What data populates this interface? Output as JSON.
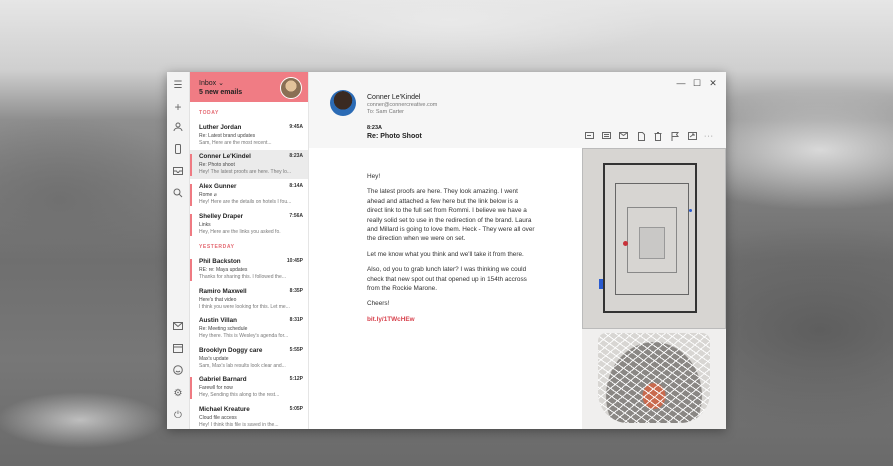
{
  "sidebar_icons": [
    "menu-icon",
    "plus-icon",
    "person-icon",
    "phone-icon",
    "inbox-tray-icon",
    "search-icon",
    "mail-icon",
    "calendar-icon",
    "smiley-icon",
    "gear-icon",
    "power-icon"
  ],
  "list": {
    "folder": "Inbox ⌄",
    "new_count": "5 new emails",
    "sections": {
      "today": "TODAY",
      "yesterday": "YESTERDAY"
    },
    "emails": [
      {
        "name": "Luther Jordan",
        "time": "9:45A",
        "subject": "Re: Latest brand updates",
        "preview": "Sam, Here are the most recent...",
        "flag": false,
        "selected": false
      },
      {
        "name": "Conner Le'Kindel",
        "time": "8:23A",
        "subject": "Re: Photo shoot",
        "preview": "Hey! The latest proofs are here. They lo...",
        "flag": true,
        "selected": true
      },
      {
        "name": "Alex Gunner",
        "time": "8:14A",
        "subject": "Rome ⌀",
        "preview": "Hey! Here are the details on hotels I fou...",
        "flag": true,
        "selected": false
      },
      {
        "name": "Shelley Draper",
        "time": "7:56A",
        "subject": "Links",
        "preview": "Hey, Here are the links you asked fo.",
        "flag": true,
        "selected": false
      },
      {
        "name": "Phil Backston",
        "time": "10:45P",
        "subject": "RE: re: Maya updates",
        "preview": "Thanks for sharing this. I followed the...",
        "flag": true,
        "selected": false
      },
      {
        "name": "Ramiro Maxwell",
        "time": "8:35P",
        "subject": "Here's that video",
        "preview": "I think you were looking for this. Let me...",
        "flag": false,
        "selected": false
      },
      {
        "name": "Austin Villan",
        "time": "8:31P",
        "subject": "Re: Meeting schedule",
        "preview": "Hey there. This is Wesley's agenda for...",
        "flag": false,
        "selected": false
      },
      {
        "name": "Brooklyn Doggy care",
        "time": "5:55P",
        "subject": "Max's update",
        "preview": "Sam, Max's lab results look clear and...",
        "flag": false,
        "selected": false
      },
      {
        "name": "Gabriel Barnard",
        "time": "5:12P",
        "subject": "Farewll for now",
        "preview": "Hey, Sending this along to the rest...",
        "flag": true,
        "selected": false
      },
      {
        "name": "Michael Kreature",
        "time": "5:05P",
        "subject": "Cloud file access",
        "preview": "Hey! I think this file is saved in the...",
        "flag": false,
        "selected": false
      }
    ]
  },
  "message": {
    "sender_name": "Conner Le'Kindel",
    "sender_email": "conner@connercreative.com",
    "to": "To: Sam Carter",
    "time": "8:23A",
    "subject": "Re: Photo Shoot",
    "paragraphs": [
      "Hey!",
      "The latest proofs are here. They look amazing. I went ahead and attached a few here but the link below is a direct link to the full set from Rommi. I believe we have a really solid set to use in the redirection of the brand. Laura and Millard is going to love them. Heck - They were all over the direction when we were on set.",
      "Let me know what you think and we'll take it from there.",
      "Also, od you to grab lunch later? I was thinking we could check that new spot out that opened up in 154th accross from the Rockie Marone.",
      "Cheers!"
    ],
    "link": "bit.ly/1TWcHEw"
  },
  "toolbar_icons": [
    "reply-icon",
    "reply-all-icon",
    "forward-icon",
    "attach-icon",
    "delete-icon",
    "flag-icon",
    "move-icon",
    "more-icon"
  ],
  "window_controls": {
    "minimize": "—",
    "maximize": "☐",
    "close": "✕"
  },
  "colors": {
    "accent": "#f07c84",
    "link": "#d8434e",
    "flag": "#ef7a82"
  }
}
